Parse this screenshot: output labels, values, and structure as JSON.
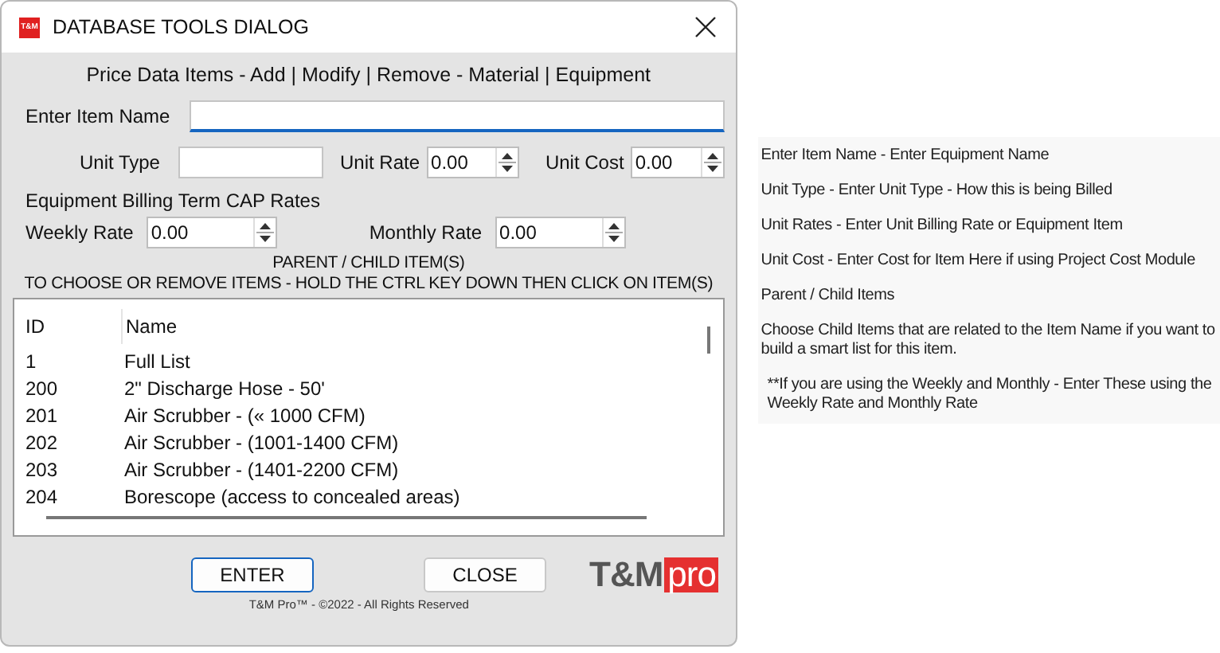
{
  "window": {
    "title": "DATABASE TOOLS DIALOG",
    "icon_text": "T&M"
  },
  "heading": "Price Data Items - Add | Modify | Remove - Material | Equipment",
  "item_name": {
    "label": "Enter Item Name",
    "focused": true
  },
  "unit_type": {
    "label": "Unit Type"
  },
  "unit_rate": {
    "label": "Unit Rate",
    "value": "0.00"
  },
  "unit_cost": {
    "label": "Unit Cost",
    "value": "0.00"
  },
  "billing_section": "Equipment Billing Term CAP Rates",
  "weekly_rate": {
    "label": "Weekly Rate",
    "value": "0.00"
  },
  "monthly_rate": {
    "label": "Monthly Rate",
    "value": "0.00"
  },
  "list_title": "PARENT / CHILD ITEM(S)",
  "list_hint": "TO CHOOSE OR REMOVE ITEMS - HOLD THE CTRL KEY DOWN THEN CLICK ON ITEM(S)",
  "table": {
    "columns": [
      "ID",
      "Name"
    ],
    "rows": [
      {
        "id": "1",
        "name": "Full List"
      },
      {
        "id": "200",
        "name": "2\" Discharge Hose - 50'"
      },
      {
        "id": "201",
        "name": "Air Scrubber - (« 1000 CFM)"
      },
      {
        "id": "202",
        "name": "Air Scrubber - (1001-1400 CFM)"
      },
      {
        "id": "203",
        "name": "Air Scrubber - (1401-2200 CFM)"
      },
      {
        "id": "204",
        "name": "Borescope (access to concealed areas)"
      }
    ]
  },
  "buttons": [
    {
      "label": "ENTER",
      "focused": true
    },
    {
      "label": "CLOSE",
      "focused": false
    }
  ],
  "logo": {
    "main": "T&M",
    "accent": "pro"
  },
  "copyright": "T&M Pro™ - ©2022 - All Rights Reserved",
  "help_notes": [
    "Enter Item Name - Enter Equipment Name",
    "Unit Type - Enter Unit Type - How this is being Billed",
    "Unit Rates - Enter Unit Billing Rate or  Equipment Item",
    "Unit Cost - Enter Cost for Item Here if using Project Cost Module",
    "Parent / Child Items",
    "Choose Child Items that are related to the Item Name if you want to build a smart list for this item.",
    "**If you are using the Weekly and Monthly - Enter These using the Weekly Rate and Monthly Rate"
  ]
}
